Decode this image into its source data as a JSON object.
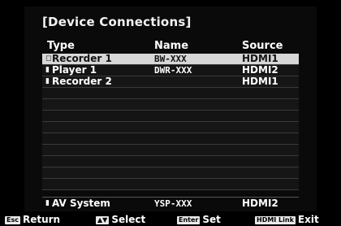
{
  "title": "[Device Connections]",
  "columns": {
    "type": "Type",
    "name": "Name",
    "source": "Source"
  },
  "devices": [
    {
      "type": "Recorder 1",
      "name": "BW-XXX",
      "source": "HDMI1",
      "selected": true,
      "mark": "◻"
    },
    {
      "type": "Player 1",
      "name": "DWR-XXX",
      "source": "HDMI2",
      "selected": false,
      "mark": "▮"
    },
    {
      "type": "Recorder 2",
      "name": "",
      "source": "HDMI1",
      "selected": false,
      "mark": "▮"
    }
  ],
  "av_system": {
    "mark": "▮",
    "type": "AV System",
    "name": "YSP-XXX",
    "source": "HDMI2"
  },
  "footer": [
    {
      "key": "Esc",
      "label": "Return"
    },
    {
      "key": "▲▼",
      "label": "Select"
    },
    {
      "key": "Enter",
      "label": "Set"
    },
    {
      "key": "HDMI Link",
      "label": "Exit"
    }
  ]
}
